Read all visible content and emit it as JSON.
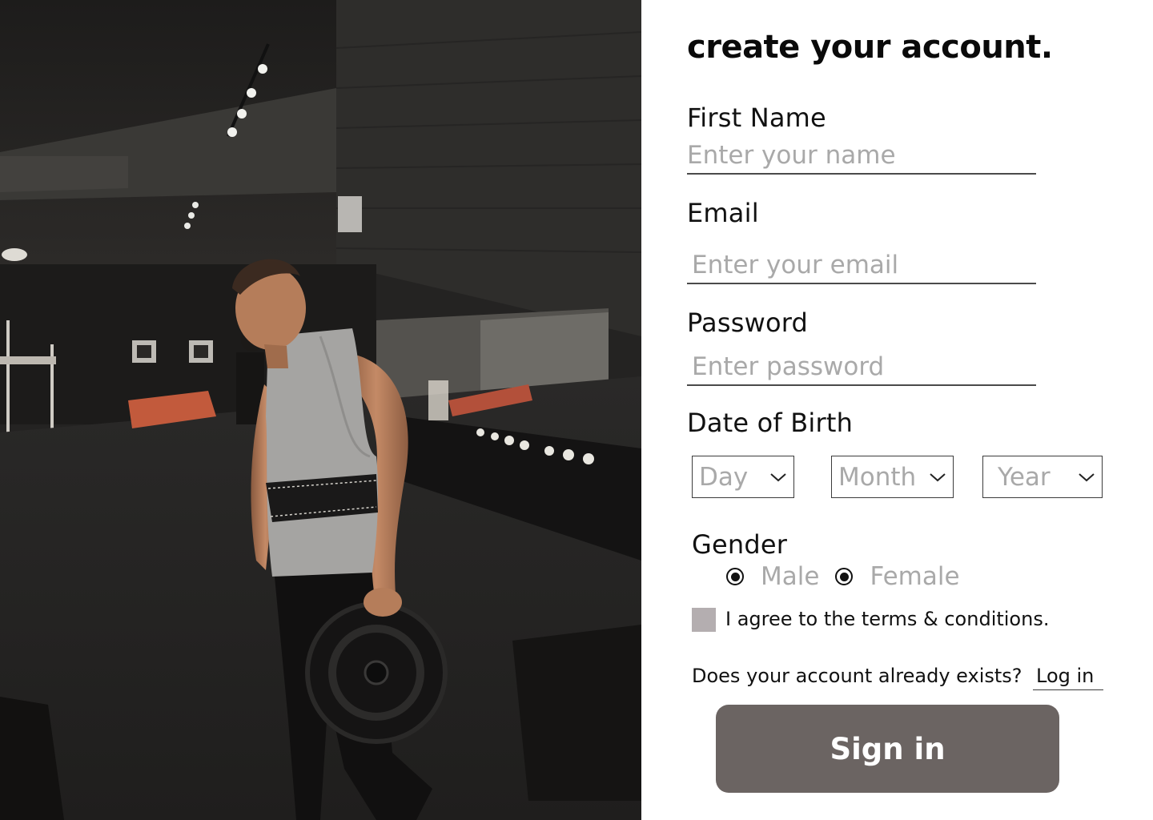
{
  "form": {
    "title": "create your account.",
    "first_name": {
      "label": "First Name",
      "placeholder": "Enter your name"
    },
    "email": {
      "label": "Email",
      "placeholder": "Enter your email"
    },
    "password": {
      "label": "Password",
      "placeholder": "Enter password"
    },
    "dob": {
      "label": "Date of Birth",
      "day": "Day",
      "month": "Month",
      "year": "Year"
    },
    "gender": {
      "label": "Gender",
      "options": [
        "Male",
        "Female"
      ]
    },
    "terms": "I agree to the terms & conditions.",
    "account_exists": "Does your account already exists?",
    "login_link": "Log in",
    "submit": "Sign in"
  },
  "colors": {
    "submit_bg": "#6b6462",
    "checkbox_bg": "#b4aeb0",
    "placeholder": "#a9a9a9"
  },
  "icons": [
    "chevron-down-icon",
    "radio-selected-icon"
  ]
}
